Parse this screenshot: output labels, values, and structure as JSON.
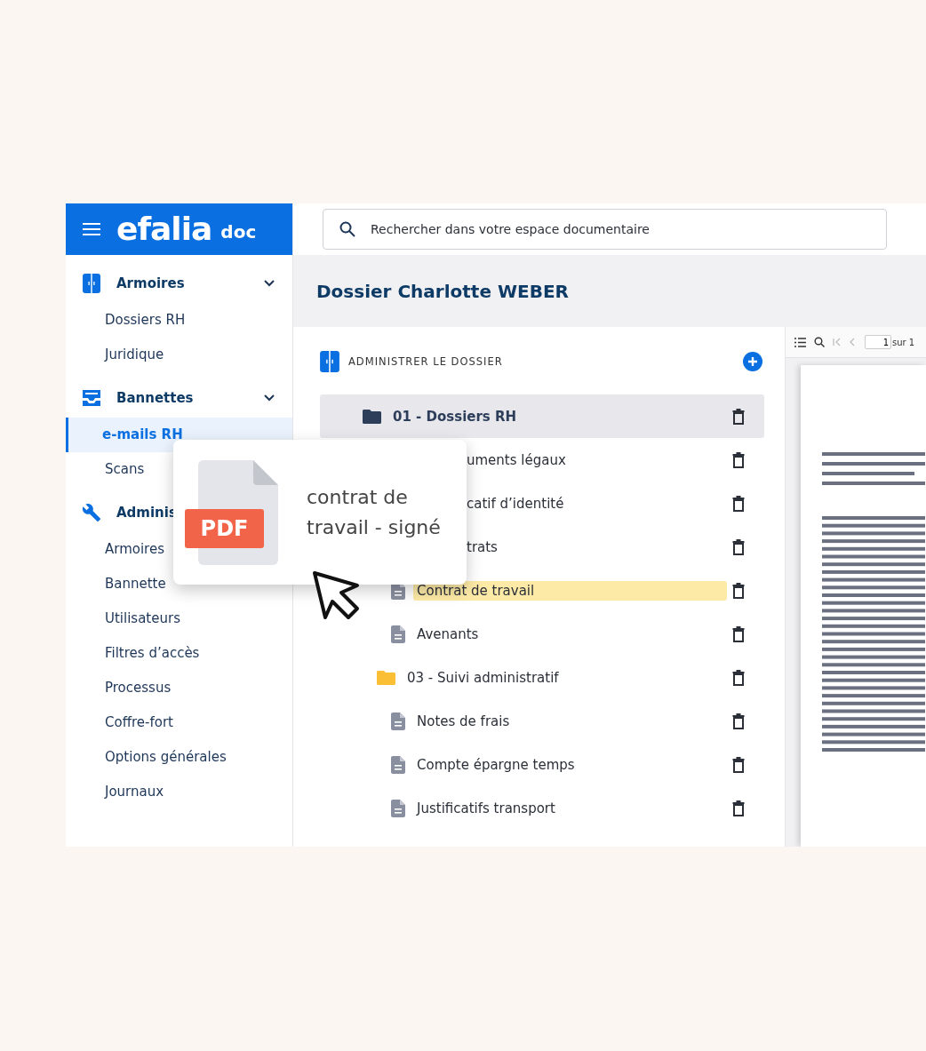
{
  "header": {
    "logo": "efalia",
    "product": "doc"
  },
  "sidebar": {
    "sections": [
      {
        "title": "Armoires",
        "expanded": true,
        "items": [
          {
            "label": "Dossiers RH",
            "selected": false
          },
          {
            "label": "Juridique",
            "selected": false
          }
        ]
      },
      {
        "title": "Bannettes",
        "expanded": true,
        "items": [
          {
            "label": "e-mails RH",
            "selected": true
          },
          {
            "label": "Scans",
            "selected": false
          }
        ]
      },
      {
        "title": "Adminis",
        "items": [
          {
            "label": "Armoires",
            "selected": false
          },
          {
            "label": "Bannette",
            "selected": false
          },
          {
            "label": "Utilisateurs",
            "selected": false
          },
          {
            "label": "Filtres d’accès",
            "selected": false
          },
          {
            "label": "Processus",
            "selected": false
          },
          {
            "label": "Coffre-fort",
            "selected": false
          },
          {
            "label": "Options générales",
            "selected": false
          },
          {
            "label": "Journaux",
            "selected": false
          }
        ]
      }
    ]
  },
  "search": {
    "placeholder": "Rechercher dans votre espace documentaire"
  },
  "page_title": "Dossier Charlotte WEBER",
  "tree": {
    "heading": "ADMINISTRER LE DOSSIER",
    "nodes": [
      {
        "kind": "folder",
        "label": "01 - Dossiers RH",
        "color": "#2d3e5a",
        "selected": true,
        "highlighted": false,
        "children": [
          {
            "kind": "partial",
            "label": "uments légaux",
            "selected": false,
            "highlighted": false
          },
          {
            "kind": "partial",
            "label": "catif d’identité",
            "selected": false,
            "highlighted": false
          },
          {
            "kind": "partial",
            "label": "trats",
            "selected": false,
            "highlighted": false,
            "children": [
              {
                "kind": "file",
                "label": "Contrat de travail",
                "selected": false,
                "highlighted": true
              },
              {
                "kind": "file",
                "label": "Avenants",
                "selected": false,
                "highlighted": false
              }
            ]
          },
          {
            "kind": "folder",
            "label": "03 - Suivi administratif",
            "color": "#fbbf35",
            "selected": false,
            "highlighted": false,
            "children": [
              {
                "kind": "file",
                "label": "Notes de frais",
                "selected": false,
                "highlighted": false
              },
              {
                "kind": "file",
                "label": "Compte épargne temps",
                "selected": false,
                "highlighted": false
              },
              {
                "kind": "file",
                "label": "Justificatifs transport",
                "selected": false,
                "highlighted": false
              }
            ]
          }
        ]
      }
    ]
  },
  "viewer": {
    "page_value": "1",
    "page_total": "sur 1"
  },
  "drag_card": {
    "badge": "PDF",
    "filename": "contrat de travail - signé"
  }
}
